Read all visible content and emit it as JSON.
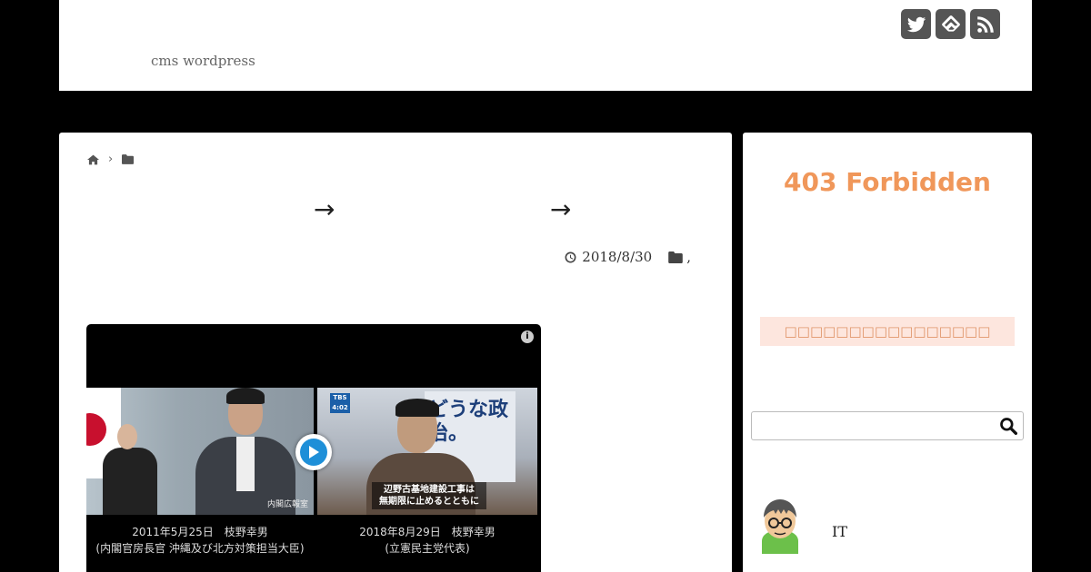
{
  "header": {
    "tagline": "cms wordpress",
    "sns": [
      "twitter-icon",
      "feedly-icon",
      "rss-icon"
    ]
  },
  "article": {
    "breadcrumb": {
      "separator": "›"
    },
    "title": {
      "arrow1": "→",
      "arrow2": "→"
    },
    "date": "2018/8/30",
    "category_suffix": ","
  },
  "video_ad": {
    "info": "i",
    "left_caption_line1": "2011年5月25日　枝野幸男",
    "left_caption_line2": "(内閣官房長官 沖縄及び北方対策担当大臣)",
    "left_watermark": "内閣広報室",
    "right_caption_line1": "2018年8月29日　枝野幸男",
    "right_caption_line2": "(立憲民主党代表)",
    "right_overlay_line1": "辺野古基地建設工事は",
    "right_overlay_line2": "無期限に止めるとともに",
    "tbs_label": "TBS",
    "tbs_time": "4:02",
    "poster_text": "どうな政治。"
  },
  "sidebar": {
    "forbidden_title": "403 Forbidden",
    "notice_text": "□□□□□□□□□□□□□□□□",
    "search_placeholder": "",
    "profile_name": "IT"
  },
  "colors": {
    "accent_orange": "#f0975a",
    "notice_bg": "#fde6de",
    "sns_bg": "#555555",
    "play_blue": "#1e8fd8"
  }
}
